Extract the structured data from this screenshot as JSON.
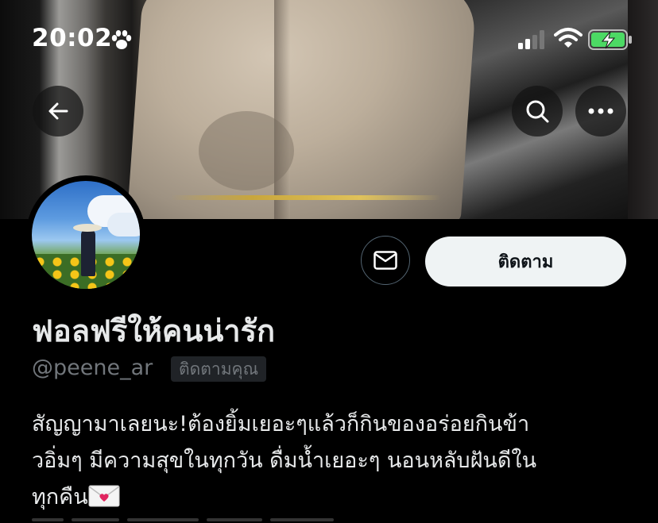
{
  "status_bar": {
    "time": "20:02",
    "icons": [
      "paw-icon",
      "cellular-signal-icon",
      "wifi-icon",
      "battery-charging-icon"
    ],
    "battery_color": "#4cd964"
  },
  "header": {
    "back_icon": "arrow-left-icon",
    "search_icon": "search-icon",
    "more_icon": "more-horizontal-icon"
  },
  "profile": {
    "display_name": "ฟอลฟรีให้คนน่ารัก",
    "handle": "@peene_ar",
    "follows_you_badge": "ติดตามคุณ",
    "follow_button_label": "ติดตาม",
    "message_icon": "envelope-icon",
    "bio_lines": [
      "สัญญามาเลยนะ!ต้องยิ้มเยอะๆแล้วก็กินของอร่อยกินข้า",
      "วอิ่มๆ มีความสุขในทุกวัน ดื่มน้ำเยอะๆ นอนหลับฝันดีใน",
      "ทุกคืน"
    ],
    "bio_emoji": "love-letter-icon"
  },
  "colors": {
    "background": "#000000",
    "primary_text": "#e7e9ea",
    "secondary_text": "#71767b",
    "follow_button_bg": "#eff3f4",
    "badge_bg": "#202327"
  }
}
